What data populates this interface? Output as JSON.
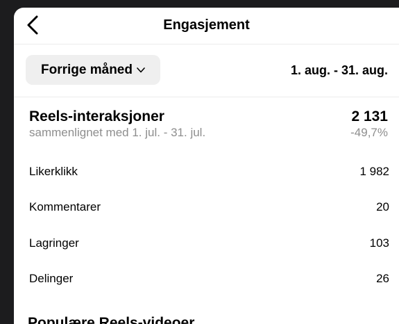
{
  "header": {
    "title": "Engasjement"
  },
  "filter": {
    "period_label": "Forrige måned",
    "date_range": "1. aug. - 31. aug."
  },
  "reels": {
    "title": "Reels-interaksjoner",
    "total": "2 131",
    "comparison": "sammenlignet med 1. jul. - 31. jul.",
    "change": "-49,7%",
    "rows": [
      {
        "label": "Likerklikk",
        "value": "1 982"
      },
      {
        "label": "Kommentarer",
        "value": "20"
      },
      {
        "label": "Lagringer",
        "value": "103"
      },
      {
        "label": "Delinger",
        "value": "26"
      }
    ]
  },
  "next_section": {
    "title": "Populære Reels-videoer"
  },
  "icons": {
    "back": "chevron-left-icon",
    "dropdown": "chevron-down-icon"
  }
}
